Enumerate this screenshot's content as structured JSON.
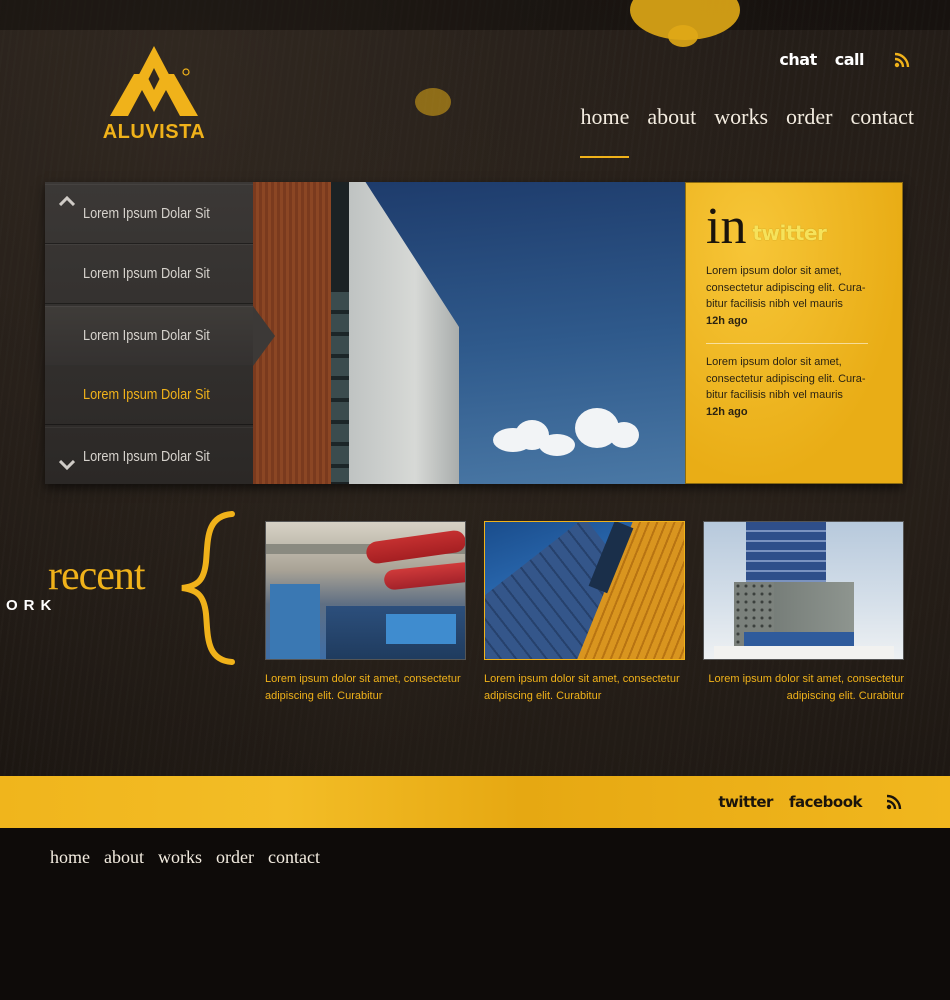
{
  "brand": {
    "name": "ALUVISTA",
    "accent_color": "#f0b21a"
  },
  "header": {
    "top_links": [
      "chat",
      "call"
    ],
    "rss_icon": "rss-icon",
    "nav": [
      {
        "label": "home",
        "active": true
      },
      {
        "label": "about",
        "active": false
      },
      {
        "label": "works",
        "active": false
      },
      {
        "label": "order",
        "active": false
      },
      {
        "label": "contact",
        "active": false
      }
    ]
  },
  "slider": {
    "up_icon": "chevron-up-icon",
    "down_icon": "chevron-down-icon",
    "items": [
      "Lorem Ipsum Dolar Sit",
      "Lorem Ipsum Dolar Sit",
      "Lorem Ipsum Dolar Sit",
      "Lorem Ipsum Dolar Sit",
      "Lorem Ipsum Dolar Sit"
    ],
    "current_index": 2,
    "highlight_index": 3
  },
  "twitter": {
    "prefix": "in",
    "word": "twitter",
    "tweets": [
      {
        "text": "Lorem ipsum dolor sit amet, consectetur adipiscing elit. Cura-bitur facilisis nibh vel mauris",
        "time": "12h ago"
      },
      {
        "text": "Lorem ipsum dolor sit amet, consectetur adipiscing elit. Cura-bitur facilisis nibh vel mauris",
        "time": "12h ago"
      }
    ]
  },
  "recent": {
    "title": "recent",
    "subtitle": "ORK",
    "works": [
      {
        "caption": "Lorem ipsum dolor sit amet, consectetur adipiscing elit. Curabitur",
        "active": false
      },
      {
        "caption": "Lorem ipsum dolor sit amet, consectetur adipiscing elit. Curabitur",
        "active": true
      },
      {
        "caption": "Lorem ipsum dolor sit amet, consectetur adipiscing elit. Curabitur",
        "active": false
      }
    ]
  },
  "footer": {
    "social": [
      "twitter",
      "facebook"
    ],
    "nav": [
      "home",
      "about",
      "works",
      "order",
      "contact"
    ]
  }
}
